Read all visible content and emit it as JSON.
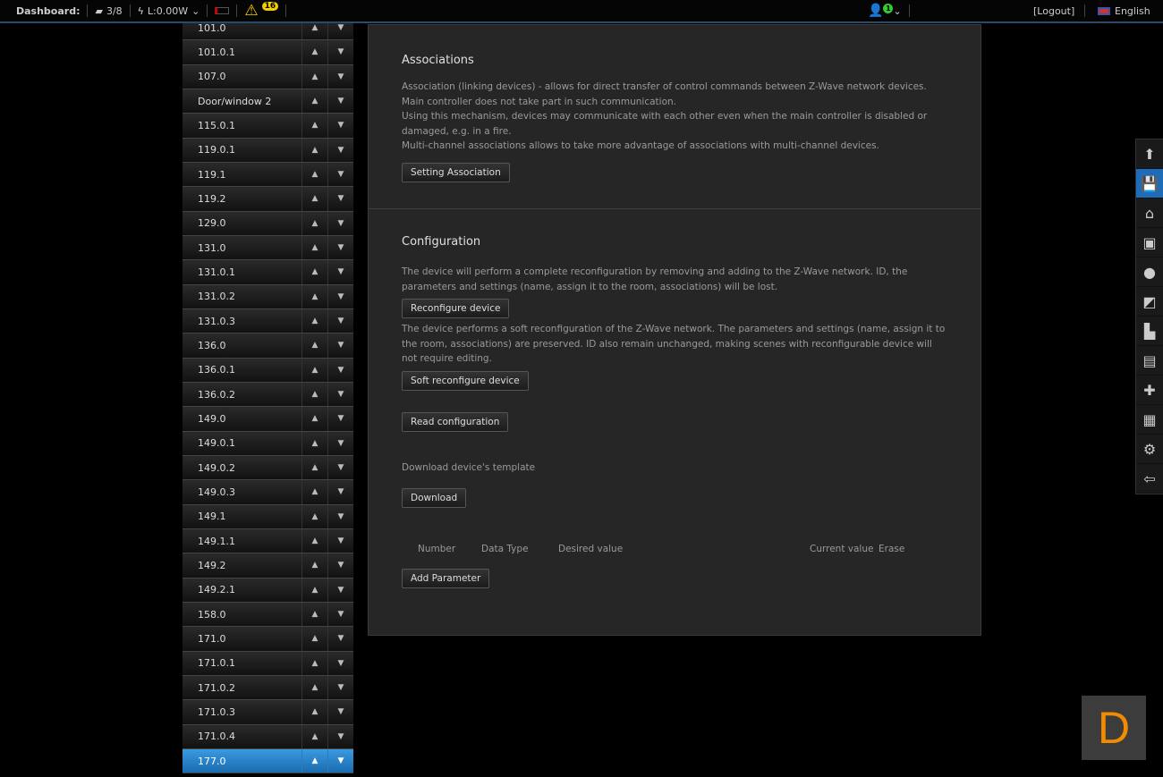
{
  "header": {
    "dashboard_label": "Dashboard:",
    "devices": "3/8",
    "power": "L:0.00W",
    "alerts": "16",
    "user_badge": "1",
    "logout": "[Logout]",
    "language": "English"
  },
  "devices": [
    "101.0",
    "101.0.1",
    "107.0",
    "Door/window 2",
    "115.0.1",
    "119.0.1",
    "119.1",
    "119.2",
    "129.0",
    "131.0",
    "131.0.1",
    "131.0.2",
    "131.0.3",
    "136.0",
    "136.0.1",
    "136.0.2",
    "149.0",
    "149.0.1",
    "149.0.2",
    "149.0.3",
    "149.1",
    "149.1.1",
    "149.2",
    "149.2.1",
    "158.0",
    "171.0",
    "171.0.1",
    "171.0.2",
    "171.0.3",
    "171.0.4",
    "177.0"
  ],
  "selected_device": "177.0",
  "associations": {
    "title": "Associations",
    "p1": "Association (linking devices) - allows for direct transfer of control commands between Z-Wave network devices. Main controller does not take part in such communication.",
    "p2": "Using this mechanism, devices may communicate with each other even when the main controller is disabled or damaged, e.g. in a fire.",
    "p3": "Multi-channel associations allows to take more advantage of associations with multi-channel devices.",
    "button": "Setting Association"
  },
  "configuration": {
    "title": "Configuration",
    "reconf_text": "The device will perform a complete reconfiguration by removing and adding to the Z-Wave network. ID, the parameters and settings (name, assign it to the room, associations) will be lost.",
    "reconf_button": "Reconfigure device",
    "soft_text": "The device performs a soft reconfiguration of the Z-Wave network. The parameters and settings (name, assign it to the room, associations) are preserved. ID also remain unchanged, making scenes with reconfigurable device will not require editing.",
    "soft_button": "Soft reconfigure device",
    "read_button": "Read configuration",
    "template_label": "Download device's template",
    "download_button": "Download",
    "columns": {
      "number": "Number",
      "data_type": "Data Type",
      "desired": "Desired value",
      "current": "Current value",
      "erase": "Erase"
    },
    "add_button": "Add Parameter"
  },
  "toolbar": [
    {
      "icon": "arrow-up-icon",
      "glyph": "⬆"
    },
    {
      "icon": "save-icon",
      "glyph": "💾",
      "active": true
    },
    {
      "icon": "home-icon",
      "glyph": "⌂"
    },
    {
      "icon": "rooms-icon",
      "glyph": "▣"
    },
    {
      "icon": "bulb-icon",
      "glyph": "●"
    },
    {
      "icon": "scene-icon",
      "glyph": "◩"
    },
    {
      "icon": "chart-icon",
      "glyph": "▙"
    },
    {
      "icon": "box-icon",
      "glyph": "▤"
    },
    {
      "icon": "puzzle-icon",
      "glyph": "✚"
    },
    {
      "icon": "calendar-icon",
      "glyph": "▦"
    },
    {
      "icon": "settings-icon",
      "glyph": "⚙"
    },
    {
      "icon": "logout-icon",
      "glyph": "⇦"
    }
  ],
  "logo": "D",
  "colors": {
    "accent": "#1e6bb8",
    "logo": "#f28b00",
    "warning": "#f0d000"
  }
}
